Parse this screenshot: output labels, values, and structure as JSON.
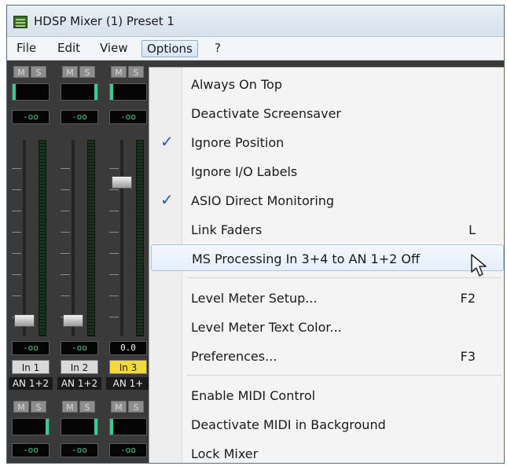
{
  "window": {
    "title": "HDSP Mixer (1) Preset 1"
  },
  "menubar": {
    "items": [
      "File",
      "Edit",
      "View",
      "Options",
      "?"
    ],
    "active": "Options"
  },
  "strips": [
    {
      "m": "M",
      "s": "S",
      "top_readout": "-oo",
      "bottom_readout": "-oo",
      "in_label": "In 1",
      "an_label": "AN 1+2",
      "m2": "M",
      "s2": "S",
      "last_readout": "-oo"
    },
    {
      "m": "M",
      "s": "S",
      "top_readout": "-oo",
      "bottom_readout": "-oo",
      "in_label": "In 2",
      "an_label": "AN 1+2",
      "m2": "M",
      "s2": "S",
      "last_readout": "-oo"
    },
    {
      "m": "M",
      "s": "S",
      "top_readout": "-oo",
      "bottom_readout": "0.0",
      "in_label": "In 3",
      "an_label": "AN 1+",
      "m2": "M",
      "s2": "S",
      "last_readout": "-oo"
    }
  ],
  "options_menu": {
    "items": [
      {
        "label": "Always On Top",
        "checked": false,
        "shortcut": ""
      },
      {
        "label": "Deactivate Screensaver",
        "checked": false,
        "shortcut": ""
      },
      {
        "label": "Ignore Position",
        "checked": true,
        "shortcut": ""
      },
      {
        "label": "Ignore I/O Labels",
        "checked": false,
        "shortcut": ""
      },
      {
        "label": "ASIO Direct Monitoring",
        "checked": true,
        "shortcut": ""
      },
      {
        "label": "Link Faders",
        "checked": false,
        "shortcut": "L"
      },
      {
        "label": "MS Processing In 3+4 to AN 1+2 Off",
        "checked": false,
        "shortcut": "",
        "hovered": true
      },
      {
        "label": "Level Meter Setup...",
        "checked": false,
        "shortcut": "F2"
      },
      {
        "label": "Level Meter Text Color...",
        "checked": false,
        "shortcut": ""
      },
      {
        "label": "Preferences...",
        "checked": false,
        "shortcut": "F3"
      },
      {
        "label": "Enable MIDI Control",
        "checked": false,
        "shortcut": ""
      },
      {
        "label": "Deactivate MIDI in Background",
        "checked": false,
        "shortcut": ""
      },
      {
        "label": "Lock Mixer",
        "checked": false,
        "shortcut": ""
      }
    ],
    "check_glyph": "✓",
    "accent_color": "#2458c6"
  }
}
